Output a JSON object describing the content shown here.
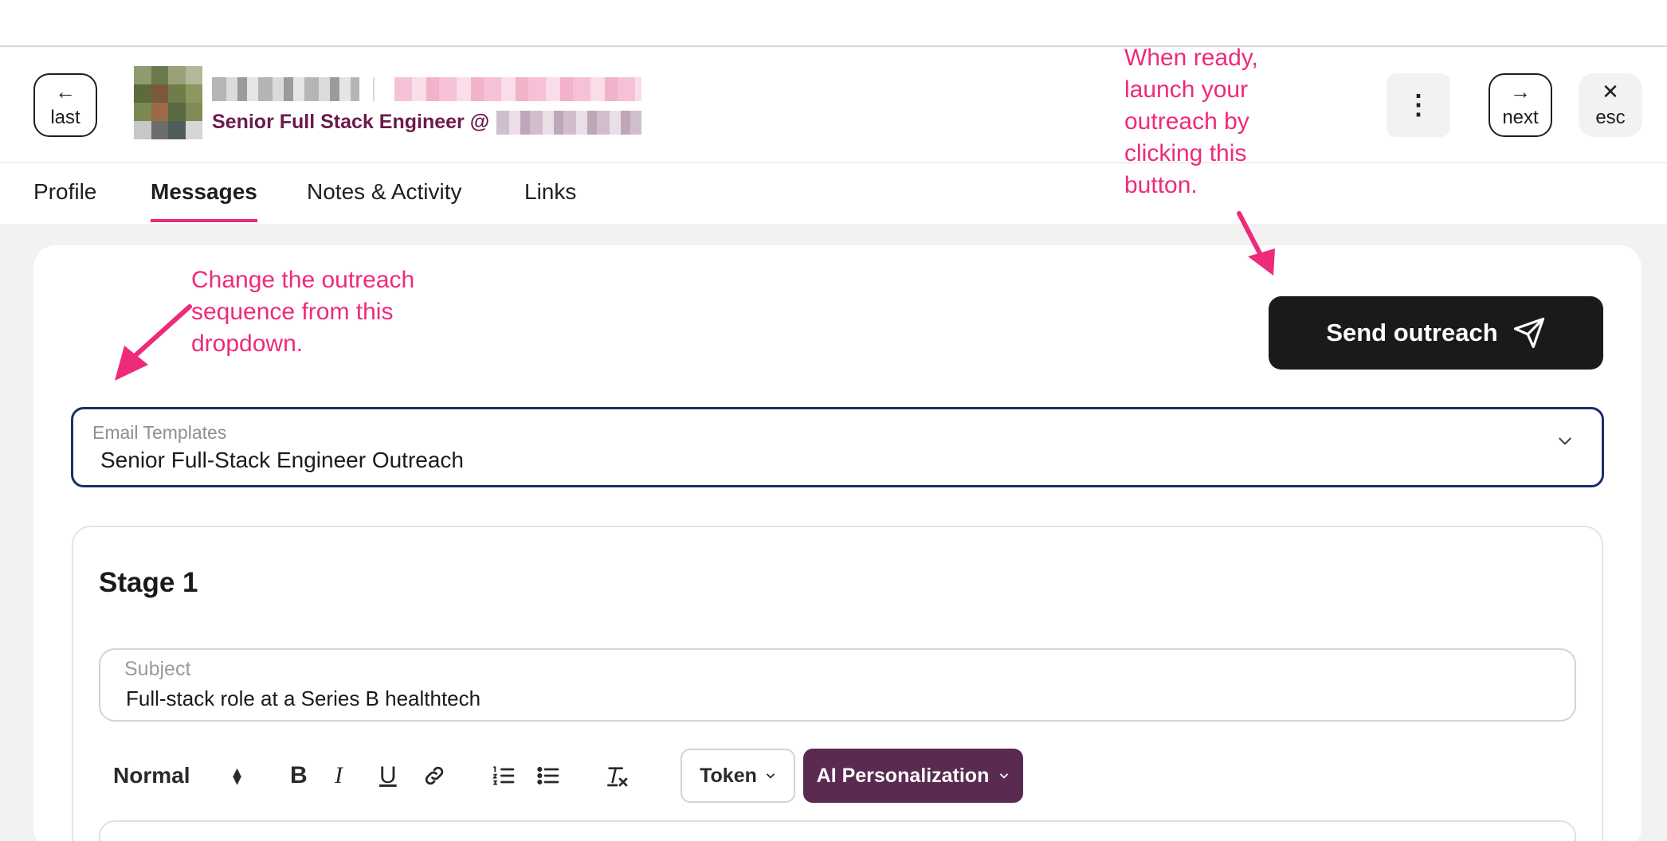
{
  "header": {
    "last_label": "last",
    "next_label": "next",
    "esc_label": "esc",
    "job_title": "Senior Full Stack Engineer @",
    "more_icon": "⋮"
  },
  "tabs": [
    {
      "label": "Profile",
      "active": false
    },
    {
      "label": "Messages",
      "active": true
    },
    {
      "label": "Notes & Activity",
      "active": false
    },
    {
      "label": "Links",
      "active": false
    }
  ],
  "send_button": {
    "label": "Send outreach"
  },
  "template_select": {
    "label": "Email Templates",
    "value": "Senior Full-Stack Engineer Outreach"
  },
  "stage": {
    "title": "Stage 1",
    "subject_label": "Subject",
    "subject_value": "Full-stack role at a Series B healthtech"
  },
  "toolbar": {
    "format_value": "Normal",
    "token_label": "Token",
    "ai_label": "AI Personalization"
  },
  "annotations": {
    "dropdown_tip": "Change the outreach sequence from this dropdown.",
    "send_tip": "When ready, launch your outreach by clicking this button."
  },
  "colors": {
    "accent": "#e0307a",
    "annotation": "#ee2a7b",
    "ai_button": "#5a2a51",
    "send_button": "#1a1a1a",
    "job_title": "#6b1a4b"
  }
}
